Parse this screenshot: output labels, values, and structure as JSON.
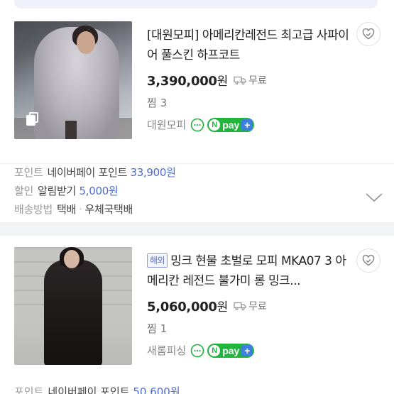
{
  "products": [
    {
      "title": "[대원모피] 아메리칸레전드 최고급 사파이어 풀스킨 하프코트",
      "price": "3,390,000",
      "price_unit": "원",
      "shipping": "무료",
      "zzim": "찜 3",
      "seller": "대원모피",
      "npay_label": "pay",
      "overseas_badge": null
    },
    {
      "title": "밍크 현물 초벌로 모피 MKA07 3 아메리칸 레전드 불가미 롱 밍크...",
      "price": "5,060,000",
      "price_unit": "원",
      "shipping": "무료",
      "zzim": "찜 1",
      "seller": "새롬피싱",
      "npay_label": "pay",
      "overseas_badge": "해외"
    }
  ],
  "benefits": {
    "point_label": "포인트",
    "point_text": "네이버페이 포인트",
    "point_value": "33,900원",
    "discount_label": "할인",
    "discount_text": "알림받기",
    "discount_value": "5,000원",
    "delivery_label": "배송방법",
    "delivery_method1": "택배",
    "delivery_sep": "·",
    "delivery_method2": "우체국택배"
  },
  "peek": {
    "point_label": "포인트",
    "point_text": "네이버페이 포인트",
    "point_value": "50,600원"
  },
  "colors": {
    "accent_blue": "#4f6bd1",
    "npay_green": "#21b53e"
  }
}
